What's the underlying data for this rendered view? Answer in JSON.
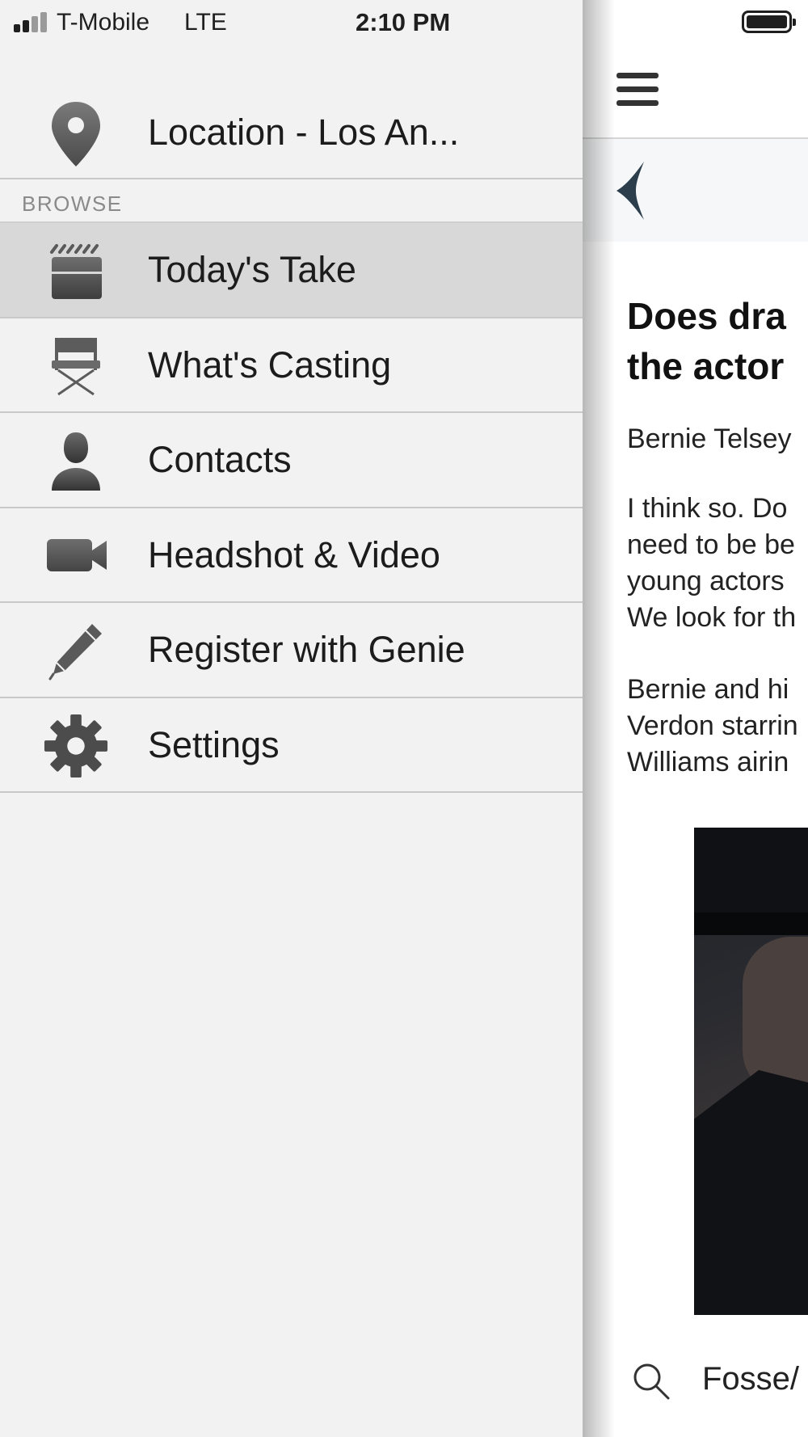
{
  "status_bar": {
    "carrier": "T-Mobile",
    "network": "LTE",
    "time": "2:10 PM"
  },
  "drawer": {
    "location": {
      "icon": "map-pin-icon",
      "label": "Location - Los An..."
    },
    "section_header": "BROWSE",
    "items": [
      {
        "label": "Today's Take",
        "icon": "clapperboard-icon",
        "active": true
      },
      {
        "label": "What's Casting",
        "icon": "director-chair-icon",
        "active": false
      },
      {
        "label": "Contacts",
        "icon": "person-icon",
        "active": false
      },
      {
        "label": "Headshot & Video",
        "icon": "video-camera-icon",
        "active": false
      },
      {
        "label": "Register with Genie",
        "icon": "pencil-icon",
        "active": false
      },
      {
        "label": "Settings",
        "icon": "gear-icon",
        "active": false
      }
    ]
  },
  "article": {
    "headline_lines": [
      "Does dra",
      "the actor"
    ],
    "byline": "Bernie Telsey",
    "paragraph1_lines": [
      "I think so. Do",
      "need to be be",
      "young actors",
      "We look for th"
    ],
    "paragraph2_lines": [
      "Bernie and hi",
      "Verdon starrin",
      "Williams airin"
    ],
    "search_text": "Fosse/"
  },
  "colors": {
    "drawer_bg": "#f2f2f2",
    "active_item_bg": "#d8d8d8",
    "divider": "#c8c8c8",
    "section_header_text": "#8a8a8a",
    "back_chevron": "#2c3e4c"
  }
}
